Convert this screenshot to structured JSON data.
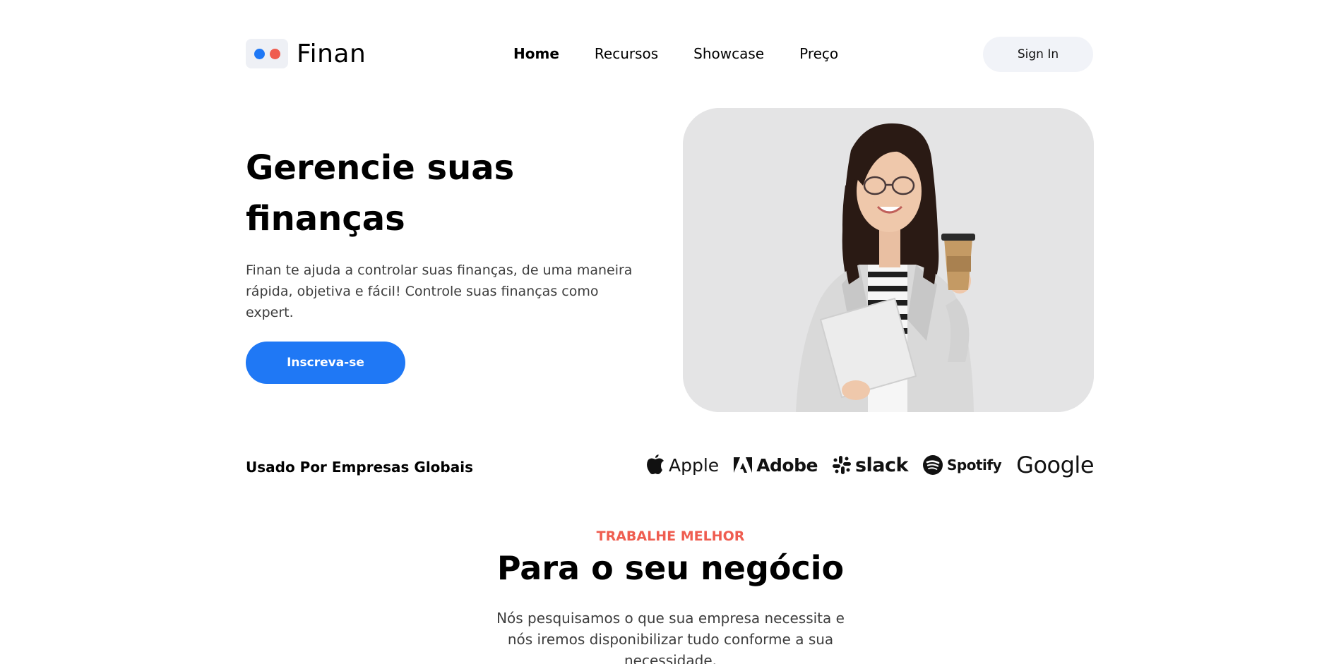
{
  "header": {
    "logo_text": "Finan",
    "nav": [
      {
        "label": "Home",
        "active": true
      },
      {
        "label": "Recursos",
        "active": false
      },
      {
        "label": "Showcase",
        "active": false
      },
      {
        "label": "Preço",
        "active": false
      }
    ],
    "signin_label": "Sign In"
  },
  "hero": {
    "title_line1": "Gerencie suas",
    "title_line2": "finanças",
    "description": "Finan te ajuda a controlar suas finanças, de uma maneira rápida, objetiva e fácil! Controle suas finanças como expert.",
    "cta_label": "Inscreva-se"
  },
  "partners": {
    "label": "Usado Por Empresas Globais",
    "brands": [
      {
        "name": "Apple",
        "icon": "apple-icon"
      },
      {
        "name": "Adobe",
        "icon": "adobe-icon"
      },
      {
        "name": "slack",
        "icon": "slack-icon"
      },
      {
        "name": "Spotify",
        "icon": "spotify-icon"
      },
      {
        "name": "Google",
        "icon": null
      }
    ]
  },
  "section": {
    "eyebrow": "TRABALHE MELHOR",
    "title": "Para o seu negócio",
    "description": "Nós pesquisamos o que sua empresa necessita e nós iremos disponibilizar tudo conforme a sua necessidade."
  },
  "colors": {
    "primary": "#1f78f5",
    "accent": "#ef5d50",
    "surface": "#f1f3f8"
  }
}
